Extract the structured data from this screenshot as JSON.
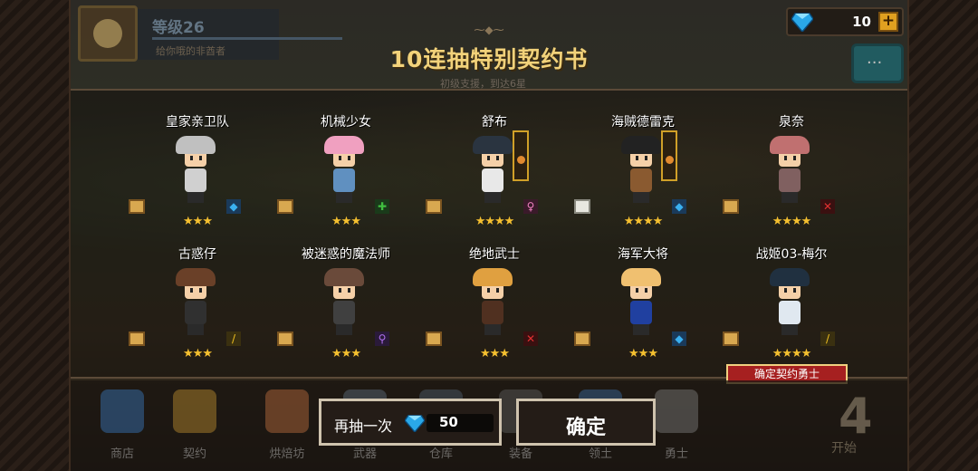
{
  "player": {
    "level": "等级26",
    "subtitle": "给你哦的非酋者"
  },
  "currency": {
    "gems": "10",
    "plus": "+"
  },
  "chat_icon": "chat-bubble-icon",
  "title": "10连抽特别契约书",
  "subtitle": "初级支援，到达6星",
  "characters": [
    {
      "name": "皇家亲卫队",
      "stars": "★★★",
      "scroll": "gold",
      "element": "blue-diamond",
      "hair": "#c0c0c0",
      "body": "#d0d0d0",
      "accent": "#c02020"
    },
    {
      "name": "机械少女",
      "stars": "★★★",
      "scroll": "gold",
      "element": "green-cross",
      "hair": "#f0a0c0",
      "body": "#6090c0",
      "accent": "#4080e0"
    },
    {
      "name": "舒布",
      "stars": "★★★★",
      "scroll": "gold",
      "element": "pink-female",
      "hair": "#2a3440",
      "body": "#e8e8e8",
      "accent": "#d0a028"
    },
    {
      "name": "海贼德雷克",
      "stars": "★★★★",
      "scroll": "white",
      "element": "blue-diamond",
      "hair": "#222",
      "body": "#8a5a30",
      "accent": "#d0a028"
    },
    {
      "name": "泉奈",
      "stars": "★★★★",
      "scroll": "gold",
      "element": "red-sword",
      "hair": "#c07070",
      "body": "#806060",
      "accent": "#c07070"
    },
    {
      "name": "古惑仔",
      "stars": "★★★",
      "scroll": "gold",
      "element": "yellow-blade",
      "hair": "#6a4028",
      "body": "#303030",
      "accent": "#ffffff"
    },
    {
      "name": "被迷惑的魔法师",
      "stars": "★★★",
      "scroll": "gold",
      "element": "purple-staff",
      "hair": "#6a4a3a",
      "body": "#404040",
      "accent": "#a070d0"
    },
    {
      "name": "绝地武士",
      "stars": "★★★",
      "scroll": "gold",
      "element": "red-sword",
      "hair": "#e0a040",
      "body": "#503020",
      "accent": "#e0a040"
    },
    {
      "name": "海军大将",
      "stars": "★★★",
      "scroll": "gold",
      "element": "blue-diamond",
      "hair": "#f0c070",
      "body": "#2040a0",
      "accent": "#202020"
    },
    {
      "name": "战姬03-梅尔",
      "stars": "★★★★",
      "scroll": "gold",
      "element": "yellow-blade",
      "hair": "#203040",
      "body": "#e0e8f0",
      "accent": "#a0b8e0"
    }
  ],
  "confirm_tag": "确定契约勇士",
  "menu": [
    {
      "label": "商店",
      "color": "#3a7ac0"
    },
    {
      "label": "契约",
      "color": "#c09030"
    },
    {
      "label": "烘焙坊",
      "color": "#c07040"
    },
    {
      "label": "武器",
      "color": "#607080"
    },
    {
      "label": "仓库",
      "color": "#506070"
    },
    {
      "label": "装备",
      "color": "#606060"
    },
    {
      "label": "领土",
      "color": "#3a6aa0"
    },
    {
      "label": "勇士",
      "color": "#808080"
    }
  ],
  "start": {
    "number": "4",
    "label": "开始"
  },
  "buttons": {
    "redraw_label": "再抽一次",
    "redraw_cost": "50",
    "confirm_label": "确定"
  },
  "colors": {
    "gold_title": "#f2d27a",
    "gem": "#2aa8e8",
    "stars": "#f5c030",
    "tag_red": "#a62020"
  }
}
